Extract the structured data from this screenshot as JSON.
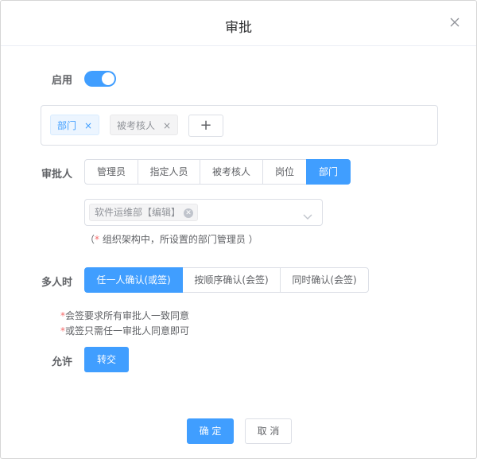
{
  "dialog": {
    "title": "审批",
    "enable_label": "启用",
    "enabled": true,
    "tags": [
      {
        "label": "部门",
        "remove": "×"
      },
      {
        "label": "被考核人",
        "remove": "×"
      }
    ],
    "add_label": "+",
    "approver": {
      "label": "审批人",
      "options": [
        "管理员",
        "指定人员",
        "被考核人",
        "岗位",
        "部门"
      ],
      "selected": "部门"
    },
    "department_select": {
      "value": "软件运维部【编辑】"
    },
    "hint": {
      "open": "（",
      "star": "*",
      "text": " 组织架构中，所设置的部门管理员 ）"
    },
    "multi": {
      "label": "多人时",
      "options": [
        "任一人确认(或签)",
        "按顺序确认(会签)",
        "同时确认(会签)"
      ],
      "selected": "任一人确认(或签)"
    },
    "notes": [
      {
        "star": "*",
        "text": "会签要求所有审批人一致同意"
      },
      {
        "star": "*",
        "text": "或签只需任一审批人同意即可"
      }
    ],
    "allow": {
      "label": "允许",
      "button": "转交"
    },
    "footer": {
      "confirm": "确 定",
      "cancel": "取 消"
    }
  },
  "colors": {
    "primary": "#409eff",
    "danger": "#f56c6c"
  }
}
